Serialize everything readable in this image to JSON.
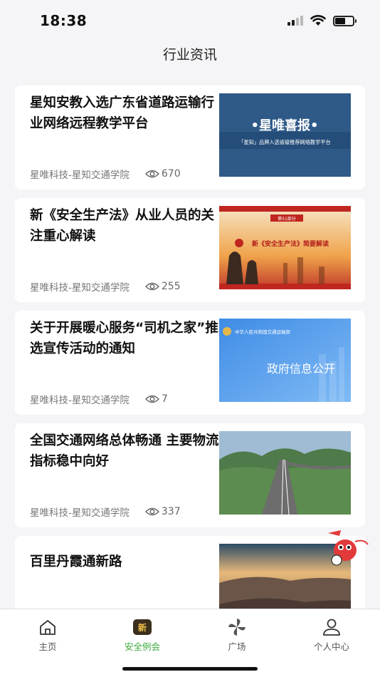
{
  "status": {
    "time": "18:38"
  },
  "header": {
    "title": "行业资讯"
  },
  "articles": [
    {
      "title": "星知安教入选广东省道路运输行业网络远程教学平台",
      "source": "星唯科技-星知交通学院",
      "views": "670",
      "thumb_title": "•星唯喜报•",
      "thumb_caption": "「星知」品牌入选省级推荐网络教学平台"
    },
    {
      "title": "新《安全生产法》从业人员的关注重心解读",
      "source": "星唯科技-星知交通学院",
      "views": "255",
      "thumb_title": "新《安全生产法》简要解读",
      "thumb_tag": "第51部分"
    },
    {
      "title": "关于开展暖心服务“司机之家”推选宣传活动的通知",
      "source": "星唯科技-星知交通学院",
      "views": "7",
      "thumb_title": "政府信息公开",
      "thumb_org": "中华人民共和国交通运输部"
    },
    {
      "title": "全国交通网络总体畅通 主要物流指标稳中向好",
      "source": "星唯科技-星知交通学院",
      "views": "337"
    },
    {
      "title": "百里丹霞通新路",
      "source": "",
      "views": ""
    }
  ],
  "tabs": [
    {
      "label": "主页",
      "icon": "home-icon"
    },
    {
      "label": "安全例会",
      "icon": "meeting-icon",
      "badge": "新"
    },
    {
      "label": "广场",
      "icon": "pinwheel-icon"
    },
    {
      "label": "个人中心",
      "icon": "user-icon"
    }
  ],
  "colors": {
    "active_tab": "#3caa3c",
    "background": "#f5f5f7",
    "card": "#ffffff"
  }
}
